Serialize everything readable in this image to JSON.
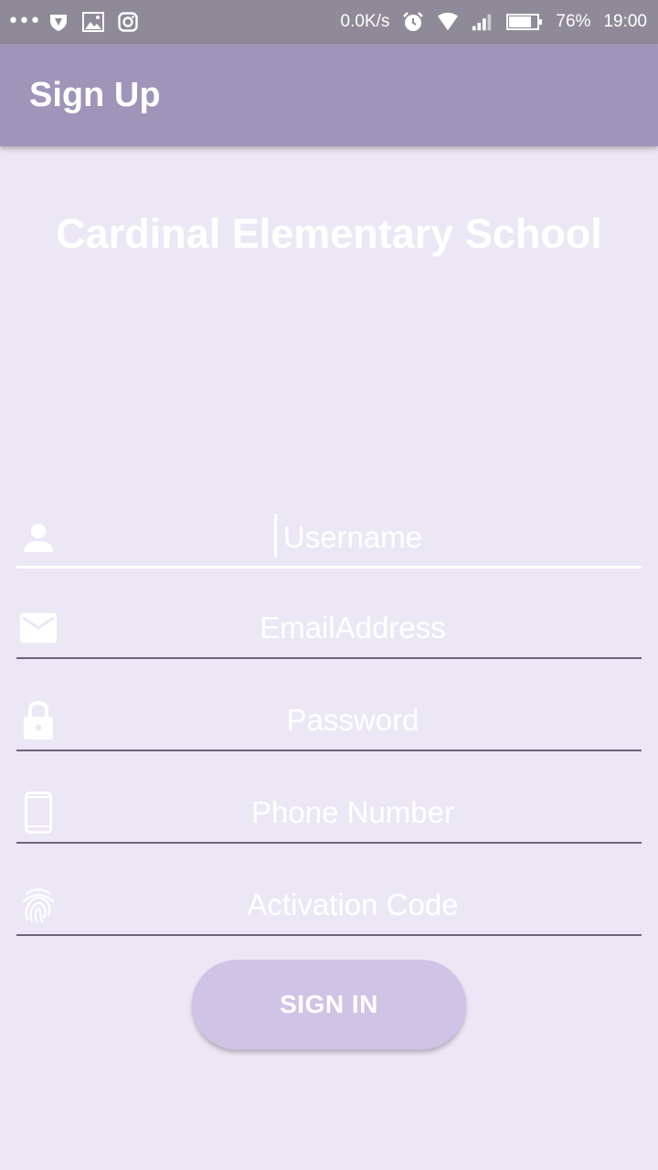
{
  "status_bar": {
    "network_speed": "0.0K/s",
    "battery": "76%",
    "time": "19:00",
    "icons_left": [
      "more-dots-icon",
      "shield-icon",
      "gallery-icon",
      "instagram-icon"
    ],
    "icons_right": [
      "alarm-icon",
      "wifi-icon",
      "signal-icon",
      "battery-icon"
    ]
  },
  "app_bar": {
    "title": "Sign Up"
  },
  "school": {
    "title": "Cardinal Elementary School"
  },
  "form": {
    "username": {
      "placeholder": "Username",
      "value": ""
    },
    "email": {
      "placeholder": "EmailAddress",
      "value": ""
    },
    "password": {
      "placeholder": "Password",
      "value": ""
    },
    "phone": {
      "placeholder": "Phone Number",
      "value": ""
    },
    "activation": {
      "placeholder": "Activation Code",
      "value": ""
    }
  },
  "sign_in_button": {
    "label": "SIGN IN"
  },
  "colors": {
    "background": "#ece7f5",
    "app_bar": "#9f95b8",
    "status_bar": "#8f8a97",
    "button": "#cfc4e6",
    "text": "#ffffff"
  }
}
